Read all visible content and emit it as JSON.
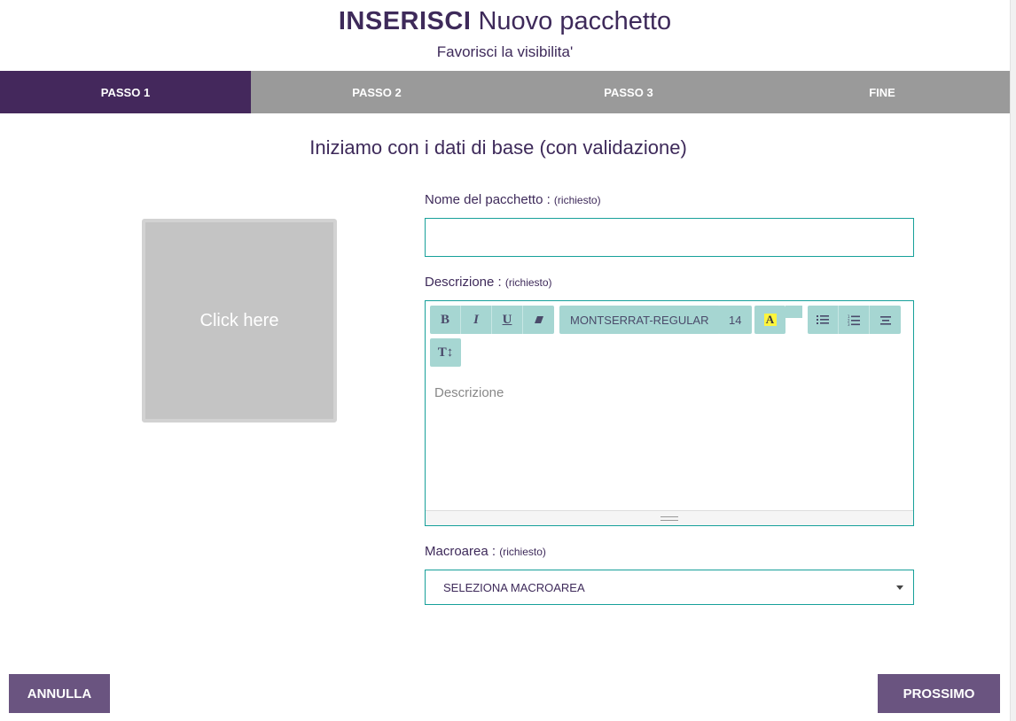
{
  "header": {
    "title_strong": "INSERISCI",
    "title_rest": "Nuovo pacchetto",
    "subtitle": "Favorisci la visibilita'"
  },
  "steps": [
    {
      "label": "PASSO 1",
      "active": true
    },
    {
      "label": "PASSO 2",
      "active": false
    },
    {
      "label": "PASSO 3",
      "active": false
    },
    {
      "label": "FINE",
      "active": false
    }
  ],
  "section_title": "Iniziamo con i dati di base (con validazione)",
  "image_upload": {
    "label": "Click here"
  },
  "name_field": {
    "label": "Nome del pacchetto :",
    "required": "(richiesto)",
    "value": ""
  },
  "description_field": {
    "label": "Descrizione :",
    "required": "(richiesto)",
    "placeholder": "Descrizione",
    "toolbar": {
      "bold": "B",
      "italic": "I",
      "underline": "U",
      "font_name": "MONTSERRAT-REGULAR",
      "font_size": "14",
      "color_letter": "A",
      "height_icon": "T↕"
    }
  },
  "macroarea_field": {
    "label": "Macroarea :",
    "required": "(richiesto)",
    "selected": "SELEZIONA MACROAREA"
  },
  "buttons": {
    "cancel": "ANNULLA",
    "next": "PROSSIMO"
  },
  "colors": {
    "primary": "#44285c",
    "step_inactive": "#9a9a9a",
    "accent_border": "#17a09a",
    "toolbar_bg": "#a6d6d2",
    "button_bg": "#6a5480"
  }
}
